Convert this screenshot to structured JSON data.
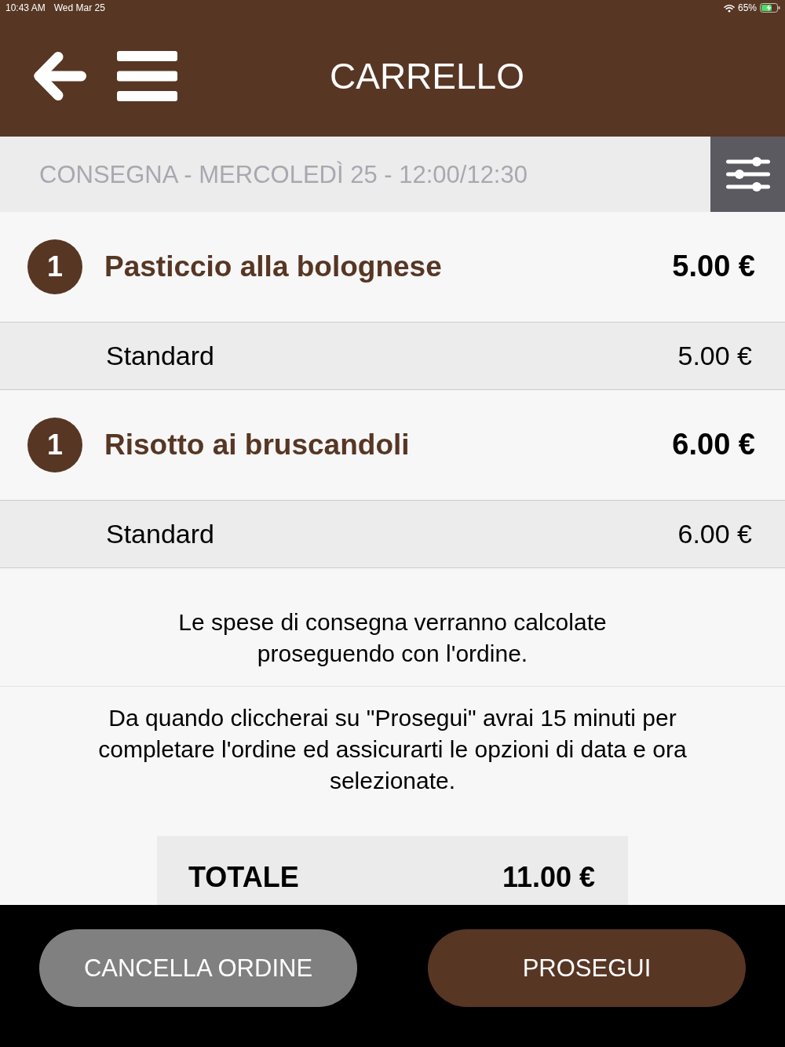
{
  "status_bar": {
    "time": "10:43 AM",
    "date": "Wed Mar 25",
    "battery": "65%"
  },
  "header": {
    "title": "CARRELLO"
  },
  "delivery": {
    "label": "CONSEGNA - MERCOLEDÌ 25 - 12:00/12:30"
  },
  "items": [
    {
      "quantity": "1",
      "name": "Pasticcio alla bolognese",
      "price": "5.00 €",
      "variant": {
        "name": "Standard",
        "price": "5.00 €"
      }
    },
    {
      "quantity": "1",
      "name": "Risotto ai bruscandoli",
      "price": "6.00 €",
      "variant": {
        "name": "Standard",
        "price": "6.00 €"
      }
    }
  ],
  "delivery_note": "Le spese di consegna verranno calcolate proseguendo con l'ordine.",
  "timer_note": "Da quando cliccherai su \"Prosegui\" avrai 15 minuti per completare l'ordine ed assicurarti le opzioni di data e ora selezionate.",
  "total": {
    "label": "TOTALE",
    "value": "11.00 €"
  },
  "buttons": [
    {
      "label": "CANCELLA ORDINE",
      "kind": "secondary"
    },
    {
      "label": "PROSEGUI",
      "kind": "primary"
    }
  ]
}
